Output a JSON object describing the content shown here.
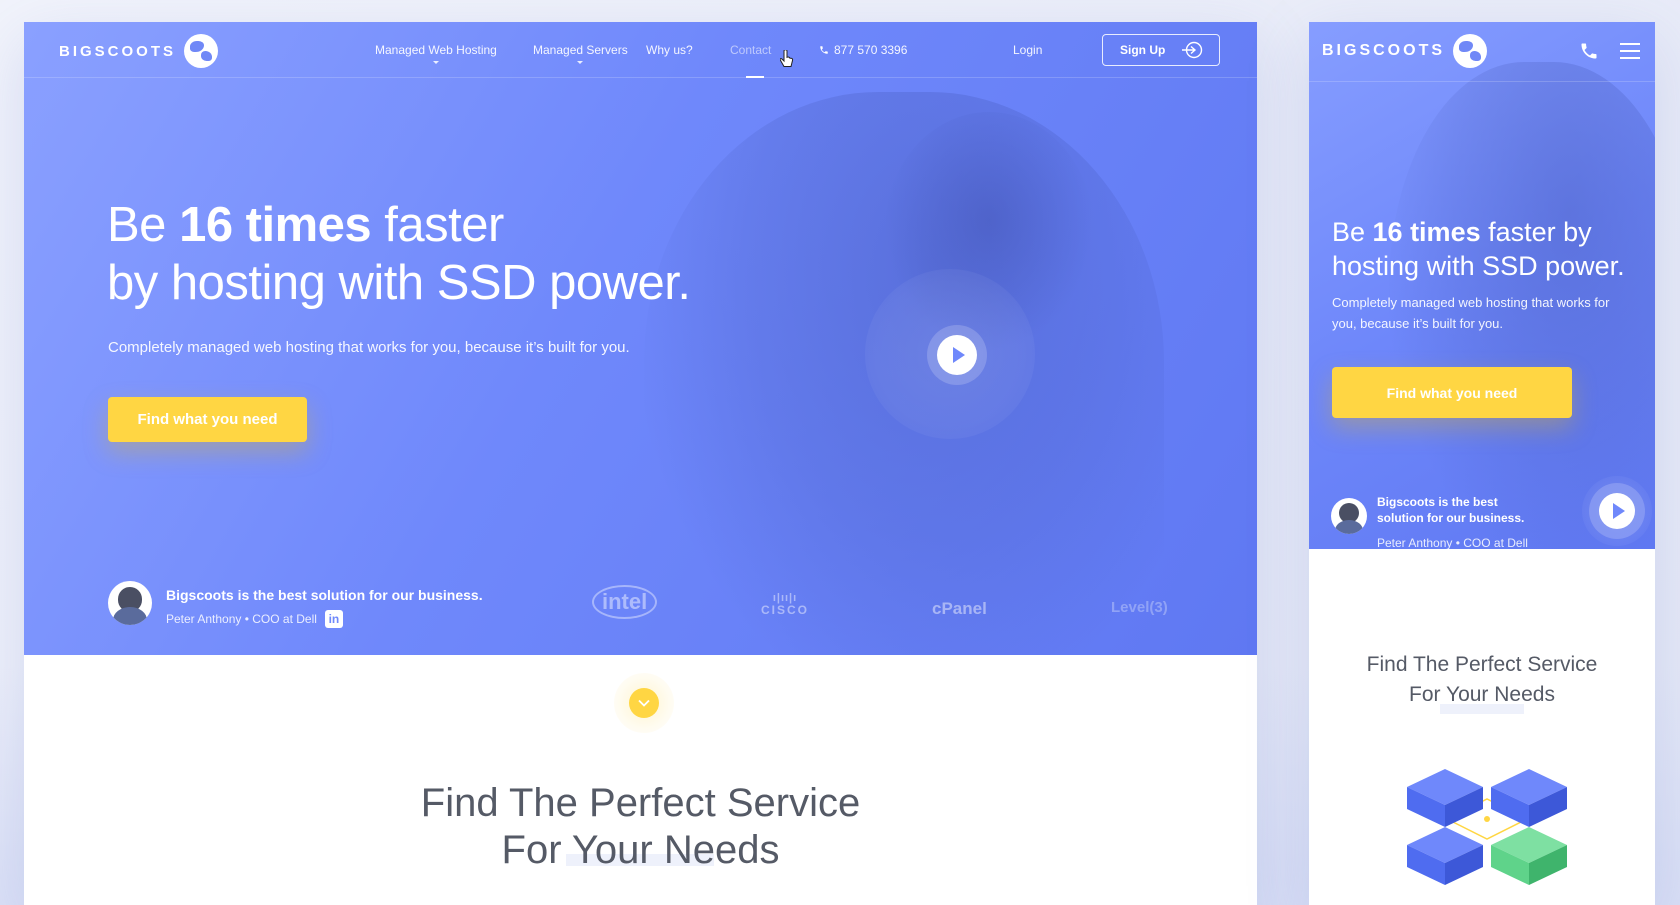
{
  "brand": {
    "name": "BIGSCOOTS"
  },
  "desktop": {
    "nav": {
      "items": [
        {
          "label": "Managed Web Hosting",
          "has_dropdown": true
        },
        {
          "label": "Managed Servers",
          "has_dropdown": true
        },
        {
          "label": "Why us?",
          "has_dropdown": false
        },
        {
          "label": "Contact",
          "has_dropdown": false,
          "active": true
        }
      ],
      "phone": "877 570 3396",
      "login": "Login",
      "signup": "Sign Up"
    },
    "hero": {
      "headline_pre": "Be ",
      "headline_bold": "16 times",
      "headline_post": " faster",
      "headline_line2": "by hosting with SSD power.",
      "subtitle": "Completely managed web hosting that works for you, because it’s built for you.",
      "cta": "Find what you need",
      "testimonial": {
        "quote": "Bigscoots is the best solution for our business.",
        "author": "Peter Anthony • COO at Dell",
        "linkedin": "in"
      },
      "partners": [
        "intel",
        "CISCO",
        "cPanel",
        "Level(3)"
      ]
    },
    "section": {
      "title_line1": "Find The Perfect Service",
      "title_line2": "For Your Needs"
    }
  },
  "mobile": {
    "hero": {
      "headline_pre": "Be ",
      "headline_bold": "16 times",
      "headline_post": " faster by",
      "headline_line2": "hosting with SSD power.",
      "subtitle": "Completely managed web hosting that works for you, because it’s built for you.",
      "cta": "Find what you need",
      "testimonial": {
        "quote": "Bigscoots is the best solution for our business.",
        "author": "Peter Anthony • COO at Dell"
      }
    },
    "section": {
      "title_line1": "Find The Perfect Service",
      "title_line2": "For Your Needs"
    }
  },
  "colors": {
    "hero_blue": "#6f88fb",
    "accent_yellow": "#ffd643",
    "server_blue": "#4f6cf0",
    "server_green": "#5fd38a",
    "title_gray": "#555a66"
  },
  "icons": [
    "globe-logo-icon",
    "phone-icon",
    "sign-in-icon",
    "play-icon",
    "linkedin-icon",
    "chevron-down-icon",
    "hamburger-menu-icon",
    "pointer-cursor-icon"
  ]
}
